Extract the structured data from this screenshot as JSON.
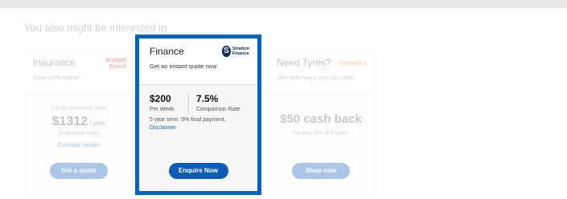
{
  "heading": "You also might be interested in",
  "colors": {
    "accent": "#0e5bb7",
    "highlight_border": "#0a63b8"
  },
  "cards": {
    "insurance": {
      "title": "Insurance",
      "subtitle": "Save 15% online*",
      "brand": "Budget Direct",
      "brand_line1": "Budget",
      "brand_line2": "Direct",
      "label": "Comprehensive from",
      "price": "$1312",
      "price_unit": " / year",
      "note": "(indicative only)",
      "link": "Estimate details",
      "button": "Get a quote"
    },
    "finance": {
      "title": "Finance",
      "subtitle": "Get an instant quote now",
      "logo_line1": "Stratton",
      "logo_line2": "Finance",
      "weekly": "$200",
      "weekly_label": "Per Week",
      "rate": "7.5%",
      "rate_label": "Comparison Rate",
      "term": "5 year term. 0% final payment.",
      "disclaimer": "Disclaimer",
      "button": "Enquire Now"
    },
    "tyres": {
      "title": "Need Tyres?",
      "subtitle": "See how much you can save",
      "brand": "tyresales",
      "offer": "$50 cash back",
      "offer_note": "on any set of 4 tyres",
      "button": "Shop now"
    }
  }
}
